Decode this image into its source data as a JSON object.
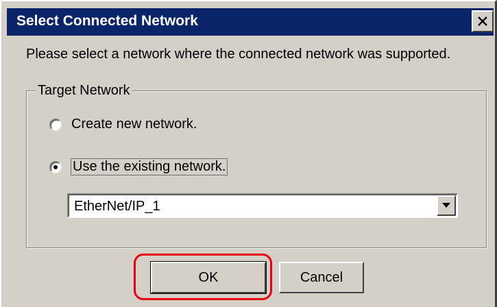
{
  "dialog": {
    "title": "Select Connected Network",
    "close_label": "X",
    "prompt": "Please select a network where the connected network was supported.",
    "group_label": "Target Network",
    "options": [
      {
        "label": "Create new network.",
        "selected": false
      },
      {
        "label": "Use the existing network.",
        "selected": true
      }
    ],
    "network_select": {
      "value": "EtherNet/IP_1"
    },
    "buttons": {
      "ok": "OK",
      "cancel": "Cancel"
    }
  },
  "colors": {
    "titlebar": "#0a246a",
    "face": "#d4d0c8",
    "highlight_ring": "#e8000b"
  },
  "icons": {
    "close": "close-icon",
    "dropdown": "chevron-down-icon",
    "radio_selected": "radio-selected-icon",
    "radio_empty": "radio-empty-icon"
  }
}
